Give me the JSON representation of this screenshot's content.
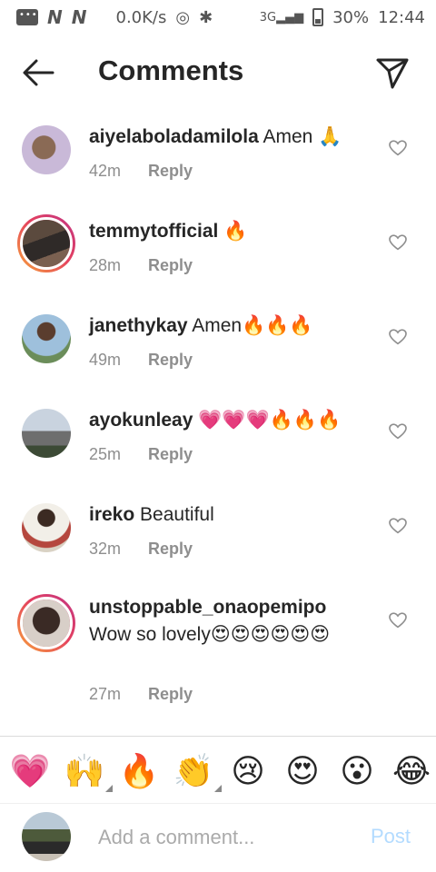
{
  "status_bar": {
    "net_speed": "0.0K/s",
    "network_type": "3G",
    "battery": "30%",
    "time": "12:44",
    "n_label": "N"
  },
  "header": {
    "title": "Comments"
  },
  "comments": [
    {
      "username": "aiyelaboladamilola",
      "text": "Amen 🙏",
      "time": "42m",
      "reply": "Reply"
    },
    {
      "username": "temmytofficial",
      "text": "🔥",
      "time": "28m",
      "reply": "Reply"
    },
    {
      "username": "janethykay",
      "text": "Amen🔥🔥🔥",
      "time": "49m",
      "reply": "Reply"
    },
    {
      "username": "ayokunleay",
      "text": "💗💗💗🔥🔥🔥",
      "time": "25m",
      "reply": "Reply"
    },
    {
      "username": "ireko",
      "text": "Beautiful",
      "time": "32m",
      "reply": "Reply"
    },
    {
      "username": "unstoppable_onaopemipo",
      "text": "Wow so lovely😍😍😍😍😍😍",
      "time": "27m",
      "reply": "Reply"
    }
  ],
  "emoji_bar": [
    "💗",
    "🙌",
    "🔥",
    "👏",
    "😢",
    "😍",
    "😮",
    "😂"
  ],
  "input": {
    "placeholder": "Add a comment...",
    "post_label": "Post"
  },
  "colors": {
    "accent_link": "#b3dbff",
    "ring_start": "#f7a23a",
    "ring_end": "#c13584",
    "meta_text": "#8e8e8e"
  }
}
